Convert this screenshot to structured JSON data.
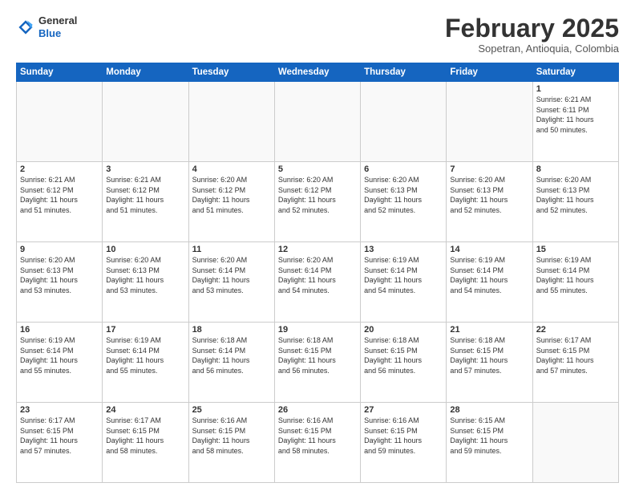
{
  "header": {
    "logo_general": "General",
    "logo_blue": "Blue",
    "month_year": "February 2025",
    "location": "Sopetran, Antioquia, Colombia"
  },
  "days_of_week": [
    "Sunday",
    "Monday",
    "Tuesday",
    "Wednesday",
    "Thursday",
    "Friday",
    "Saturday"
  ],
  "weeks": [
    [
      {
        "day": "",
        "info": ""
      },
      {
        "day": "",
        "info": ""
      },
      {
        "day": "",
        "info": ""
      },
      {
        "day": "",
        "info": ""
      },
      {
        "day": "",
        "info": ""
      },
      {
        "day": "",
        "info": ""
      },
      {
        "day": "1",
        "info": "Sunrise: 6:21 AM\nSunset: 6:11 PM\nDaylight: 11 hours\nand 50 minutes."
      }
    ],
    [
      {
        "day": "2",
        "info": "Sunrise: 6:21 AM\nSunset: 6:12 PM\nDaylight: 11 hours\nand 51 minutes."
      },
      {
        "day": "3",
        "info": "Sunrise: 6:21 AM\nSunset: 6:12 PM\nDaylight: 11 hours\nand 51 minutes."
      },
      {
        "day": "4",
        "info": "Sunrise: 6:20 AM\nSunset: 6:12 PM\nDaylight: 11 hours\nand 51 minutes."
      },
      {
        "day": "5",
        "info": "Sunrise: 6:20 AM\nSunset: 6:12 PM\nDaylight: 11 hours\nand 52 minutes."
      },
      {
        "day": "6",
        "info": "Sunrise: 6:20 AM\nSunset: 6:13 PM\nDaylight: 11 hours\nand 52 minutes."
      },
      {
        "day": "7",
        "info": "Sunrise: 6:20 AM\nSunset: 6:13 PM\nDaylight: 11 hours\nand 52 minutes."
      },
      {
        "day": "8",
        "info": "Sunrise: 6:20 AM\nSunset: 6:13 PM\nDaylight: 11 hours\nand 52 minutes."
      }
    ],
    [
      {
        "day": "9",
        "info": "Sunrise: 6:20 AM\nSunset: 6:13 PM\nDaylight: 11 hours\nand 53 minutes."
      },
      {
        "day": "10",
        "info": "Sunrise: 6:20 AM\nSunset: 6:13 PM\nDaylight: 11 hours\nand 53 minutes."
      },
      {
        "day": "11",
        "info": "Sunrise: 6:20 AM\nSunset: 6:14 PM\nDaylight: 11 hours\nand 53 minutes."
      },
      {
        "day": "12",
        "info": "Sunrise: 6:20 AM\nSunset: 6:14 PM\nDaylight: 11 hours\nand 54 minutes."
      },
      {
        "day": "13",
        "info": "Sunrise: 6:19 AM\nSunset: 6:14 PM\nDaylight: 11 hours\nand 54 minutes."
      },
      {
        "day": "14",
        "info": "Sunrise: 6:19 AM\nSunset: 6:14 PM\nDaylight: 11 hours\nand 54 minutes."
      },
      {
        "day": "15",
        "info": "Sunrise: 6:19 AM\nSunset: 6:14 PM\nDaylight: 11 hours\nand 55 minutes."
      }
    ],
    [
      {
        "day": "16",
        "info": "Sunrise: 6:19 AM\nSunset: 6:14 PM\nDaylight: 11 hours\nand 55 minutes."
      },
      {
        "day": "17",
        "info": "Sunrise: 6:19 AM\nSunset: 6:14 PM\nDaylight: 11 hours\nand 55 minutes."
      },
      {
        "day": "18",
        "info": "Sunrise: 6:18 AM\nSunset: 6:14 PM\nDaylight: 11 hours\nand 56 minutes."
      },
      {
        "day": "19",
        "info": "Sunrise: 6:18 AM\nSunset: 6:15 PM\nDaylight: 11 hours\nand 56 minutes."
      },
      {
        "day": "20",
        "info": "Sunrise: 6:18 AM\nSunset: 6:15 PM\nDaylight: 11 hours\nand 56 minutes."
      },
      {
        "day": "21",
        "info": "Sunrise: 6:18 AM\nSunset: 6:15 PM\nDaylight: 11 hours\nand 57 minutes."
      },
      {
        "day": "22",
        "info": "Sunrise: 6:17 AM\nSunset: 6:15 PM\nDaylight: 11 hours\nand 57 minutes."
      }
    ],
    [
      {
        "day": "23",
        "info": "Sunrise: 6:17 AM\nSunset: 6:15 PM\nDaylight: 11 hours\nand 57 minutes."
      },
      {
        "day": "24",
        "info": "Sunrise: 6:17 AM\nSunset: 6:15 PM\nDaylight: 11 hours\nand 58 minutes."
      },
      {
        "day": "25",
        "info": "Sunrise: 6:16 AM\nSunset: 6:15 PM\nDaylight: 11 hours\nand 58 minutes."
      },
      {
        "day": "26",
        "info": "Sunrise: 6:16 AM\nSunset: 6:15 PM\nDaylight: 11 hours\nand 58 minutes."
      },
      {
        "day": "27",
        "info": "Sunrise: 6:16 AM\nSunset: 6:15 PM\nDaylight: 11 hours\nand 59 minutes."
      },
      {
        "day": "28",
        "info": "Sunrise: 6:15 AM\nSunset: 6:15 PM\nDaylight: 11 hours\nand 59 minutes."
      },
      {
        "day": "",
        "info": ""
      }
    ]
  ]
}
